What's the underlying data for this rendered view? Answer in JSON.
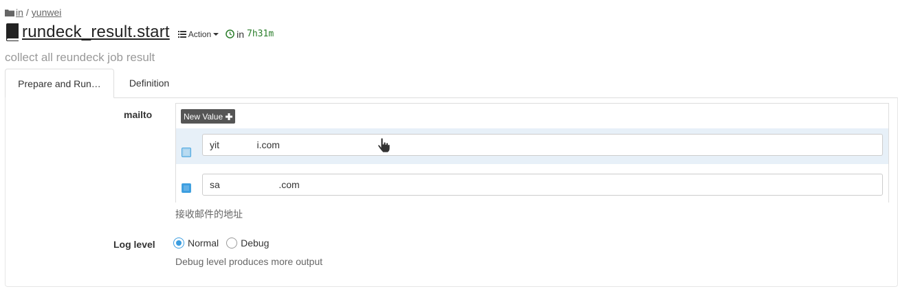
{
  "breadcrumb": {
    "icon": "folder-icon",
    "group": "in",
    "separator": "/",
    "project": "yunwei"
  },
  "job": {
    "icon": "book-icon",
    "title": "rundeck_result.start",
    "action_label": "Action",
    "schedule_prefix": "in",
    "schedule_time": "7h31m",
    "description": "collect all reundeck job result"
  },
  "tabs": [
    {
      "label": "Prepare and Run…",
      "active": true
    },
    {
      "label": "Definition",
      "active": false
    }
  ],
  "options": {
    "mailto": {
      "label": "mailto",
      "new_value_label": "New Value",
      "values": [
        {
          "text": "yit              i.com",
          "checked": true,
          "highlighted": true
        },
        {
          "text": "sa                      .com",
          "checked": true,
          "highlighted": false
        }
      ],
      "hint": "接收邮件的地址"
    },
    "log_level": {
      "label": "Log level",
      "choices": [
        {
          "label": "Normal",
          "selected": true
        },
        {
          "label": "Debug",
          "selected": false
        }
      ],
      "hint": "Debug level produces more output"
    }
  },
  "colors": {
    "accent": "#3b9de0",
    "schedule": "#2a7d2a",
    "button_bg": "#555555"
  }
}
